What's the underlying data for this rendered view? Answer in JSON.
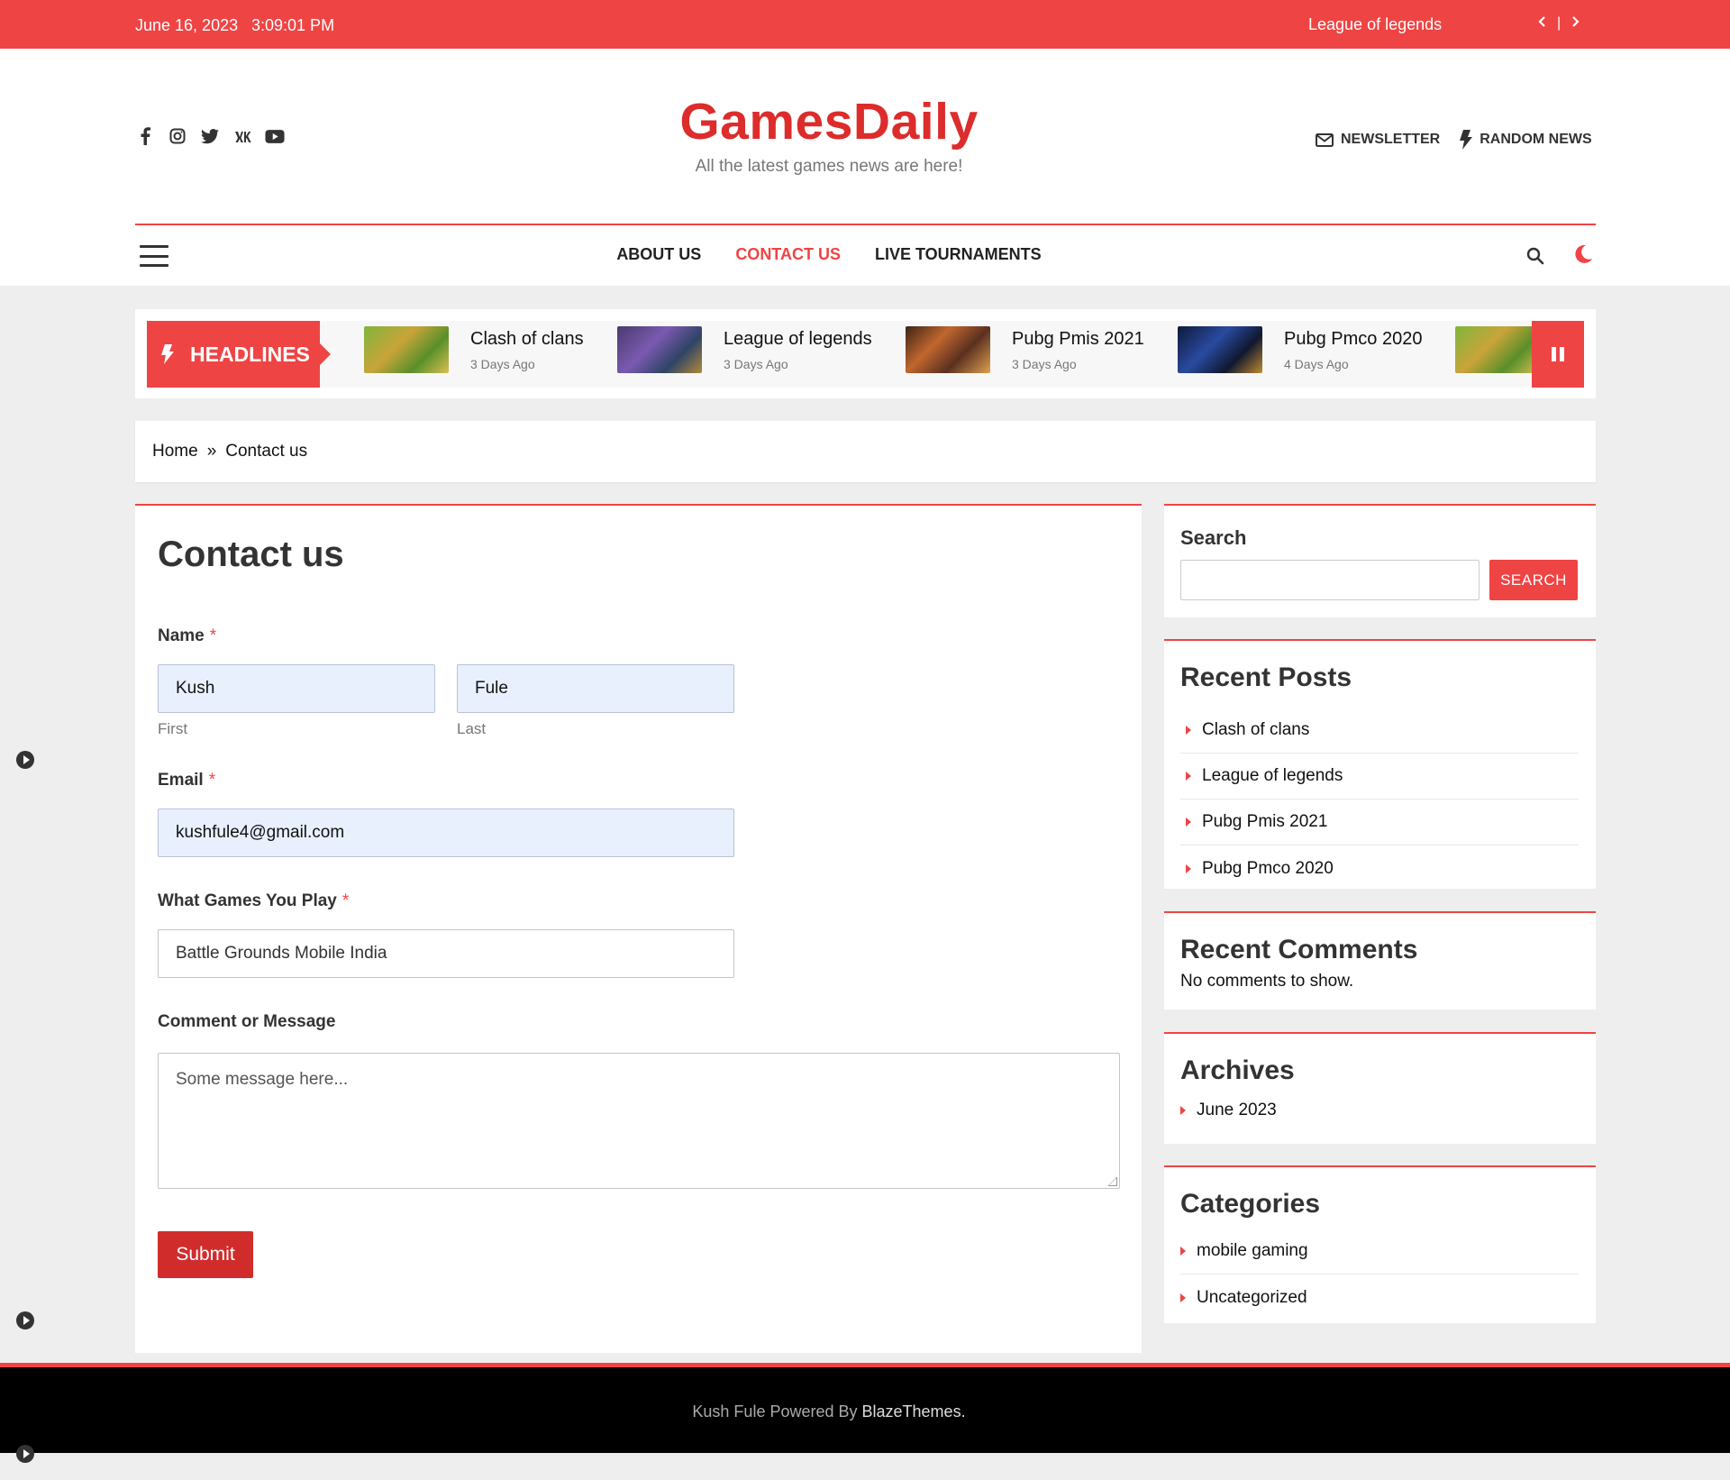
{
  "topbar": {
    "date": "June 16, 2023",
    "time": "3:09:01 PM",
    "ticker": "League of legends",
    "separator": "|"
  },
  "header": {
    "site_title": "GamesDaily",
    "tagline": "All the latest games news are here!",
    "newsletter": "NEWSLETTER",
    "random_news": "RANDOM NEWS",
    "socials": [
      "facebook-icon",
      "instagram-icon",
      "twitter-icon",
      "vk-icon",
      "youtube-icon"
    ]
  },
  "nav": {
    "items": [
      "ABOUT US",
      "CONTACT US",
      "LIVE TOURNAMENTS"
    ],
    "active": "CONTACT US"
  },
  "headlines": {
    "label": "HEADLINES",
    "items": [
      {
        "title": "Clash of clans",
        "date": "3 Days Ago"
      },
      {
        "title": "League of legends",
        "date": "3 Days Ago"
      },
      {
        "title": "Pubg Pmis 2021",
        "date": "3 Days Ago"
      },
      {
        "title": "Pubg Pmco 2020",
        "date": "4 Days Ago"
      }
    ]
  },
  "breadcrumb": {
    "home": "Home",
    "sep": "»",
    "current": "Contact us"
  },
  "form": {
    "title": "Contact us",
    "name_label": "Name",
    "required_mark": "*",
    "first_value": "Kush",
    "last_value": "Fule",
    "first_sub": "First",
    "last_sub": "Last",
    "email_label": "Email",
    "email_value": "kushfule4@gmail.com",
    "games_label": "What Games You Play",
    "games_value": "Battle Grounds Mobile India",
    "message_label": "Comment or Message",
    "message_placeholder": "Some message here...",
    "submit": "Submit"
  },
  "sidebar": {
    "search_title": "Search",
    "search_button": "SEARCH",
    "recent_posts_title": "Recent Posts",
    "recent_posts": [
      "Clash of clans",
      "League of legends",
      "Pubg Pmis 2021",
      "Pubg Pmco 2020"
    ],
    "recent_comments_title": "Recent Comments",
    "no_comments": "No comments to show.",
    "archives_title": "Archives",
    "archives": [
      "June 2023"
    ],
    "categories_title": "Categories",
    "categories": [
      "mobile gaming",
      "Uncategorized"
    ]
  },
  "footer": {
    "text": "Kush Fule Powered By",
    "link": "BlazeThemes."
  },
  "colors": {
    "accent": "#ef4444",
    "button": "#d12c2c",
    "footer_bg": "#000000"
  }
}
